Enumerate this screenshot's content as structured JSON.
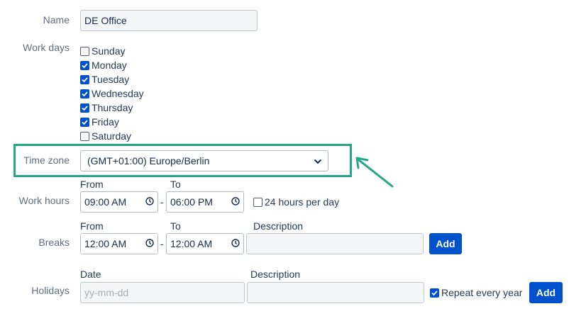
{
  "name": {
    "label": "Name",
    "value": "DE Office"
  },
  "work_days": {
    "label": "Work days",
    "days": [
      {
        "label": "Sunday",
        "checked": false
      },
      {
        "label": "Monday",
        "checked": true
      },
      {
        "label": "Tuesday",
        "checked": true
      },
      {
        "label": "Wednesday",
        "checked": true
      },
      {
        "label": "Thursday",
        "checked": true
      },
      {
        "label": "Friday",
        "checked": true
      },
      {
        "label": "Saturday",
        "checked": false
      }
    ]
  },
  "time_zone": {
    "label": "Time zone",
    "value": "(GMT+01:00) Europe/Berlin"
  },
  "work_hours": {
    "label": "Work hours",
    "from_label": "From",
    "to_label": "To",
    "from": "09:00 AM",
    "to": "06:00 PM",
    "separator": "-",
    "all_day_label": "24 hours per day",
    "all_day_checked": false
  },
  "breaks": {
    "label": "Breaks",
    "from_label": "From",
    "to_label": "To",
    "description_label": "Description",
    "from": "12:00 AM",
    "to": "12:00 AM",
    "separator": "-",
    "description": "",
    "add_label": "Add"
  },
  "holidays": {
    "label": "Holidays",
    "date_label": "Date",
    "description_label": "Description",
    "date_placeholder": "yy-mm-dd",
    "description": "",
    "repeat_label": "Repeat every year",
    "repeat_checked": true,
    "add_label": "Add"
  },
  "colors": {
    "accent": "#0052cc",
    "highlight": "#26a689"
  },
  "icons": {
    "clock": "clock-icon",
    "chevron": "chevron-down-icon",
    "arrow": "annotation-arrow-icon"
  }
}
